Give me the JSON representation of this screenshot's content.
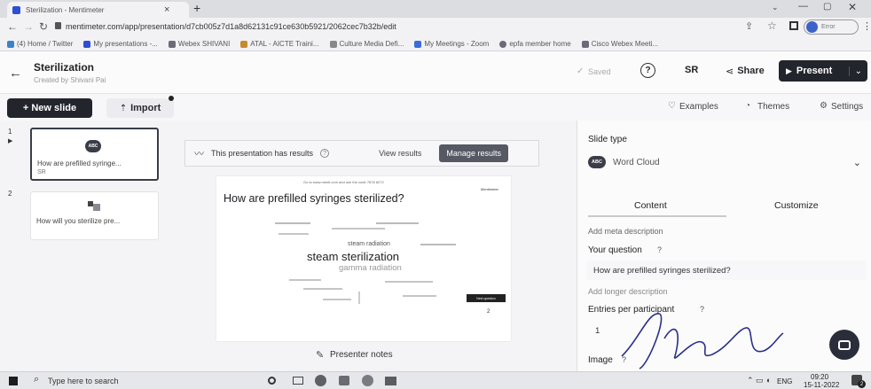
{
  "browser": {
    "tab_title": "Sterilization - Mentimeter",
    "tab_close": "×",
    "new_tab": "+",
    "url": "mentimeter.com/app/presentation/d7cb005z7d1a8d62131c91ce630b5921/2062cec7b32b/edit",
    "profile": "Error",
    "bookmarks": [
      "(4) Home / Twitter",
      "My presentations -...",
      "Webex SHIVANI",
      "ATAL - AICTE Traini...",
      "Culture Media Defi...",
      "My Meetings - Zoom",
      "epfa member home",
      "Cisco Webex Meeti..."
    ]
  },
  "header": {
    "title": "Sterilization",
    "subtitle": "Created by Shivani Pai",
    "saved": "Saved",
    "help": "?",
    "initials": "SR",
    "share": "Share",
    "present": "Present"
  },
  "toolbar": {
    "new_slide": "+ New slide",
    "import": "Import",
    "examples": "Examples",
    "themes": "Themes",
    "settings": "Settings"
  },
  "slides": [
    {
      "num": "1",
      "title": "How are prefilled syringe...",
      "meta": "SR"
    },
    {
      "num": "2",
      "title": "How will you sterilize pre..."
    }
  ],
  "results_bar": {
    "text": "This presentation has results",
    "view": "View results",
    "manage": "Manage results"
  },
  "slide_preview": {
    "top_note": "Go to www.menti.com and use the code 7878 8272",
    "logo": "Mentimeter",
    "question": "How are prefilled syringes sterilized?",
    "words": [
      {
        "text": "steam sterilization",
        "weight": 1.0
      },
      {
        "text": "gamma radiation",
        "weight": 0.7
      },
      {
        "text": "steam radiation",
        "weight": 0.45
      }
    ],
    "corner_button": "Next question",
    "count": "2"
  },
  "presenter_notes": "Presenter notes",
  "panel": {
    "slide_type_label": "Slide type",
    "slide_type": "Word Cloud",
    "tabs": [
      "Content",
      "Customize"
    ],
    "meta_description": "Add meta description",
    "question_label": "Your question",
    "question_help": "?",
    "question_value": "How are prefilled syringes sterilized?",
    "longer_description": "Add longer description",
    "entries_label": "Entries per participant",
    "entries_help": "?",
    "entries_value": "1",
    "image_label": "Image",
    "image_help": "?"
  },
  "taskbar": {
    "search_placeholder": "Type here to search",
    "lang": "ENG",
    "time": "09:20",
    "date": "15-11-2022",
    "notif": "2"
  },
  "colors": {
    "accent_dark": "#23252d",
    "link_blue": "#3b5bdb"
  }
}
